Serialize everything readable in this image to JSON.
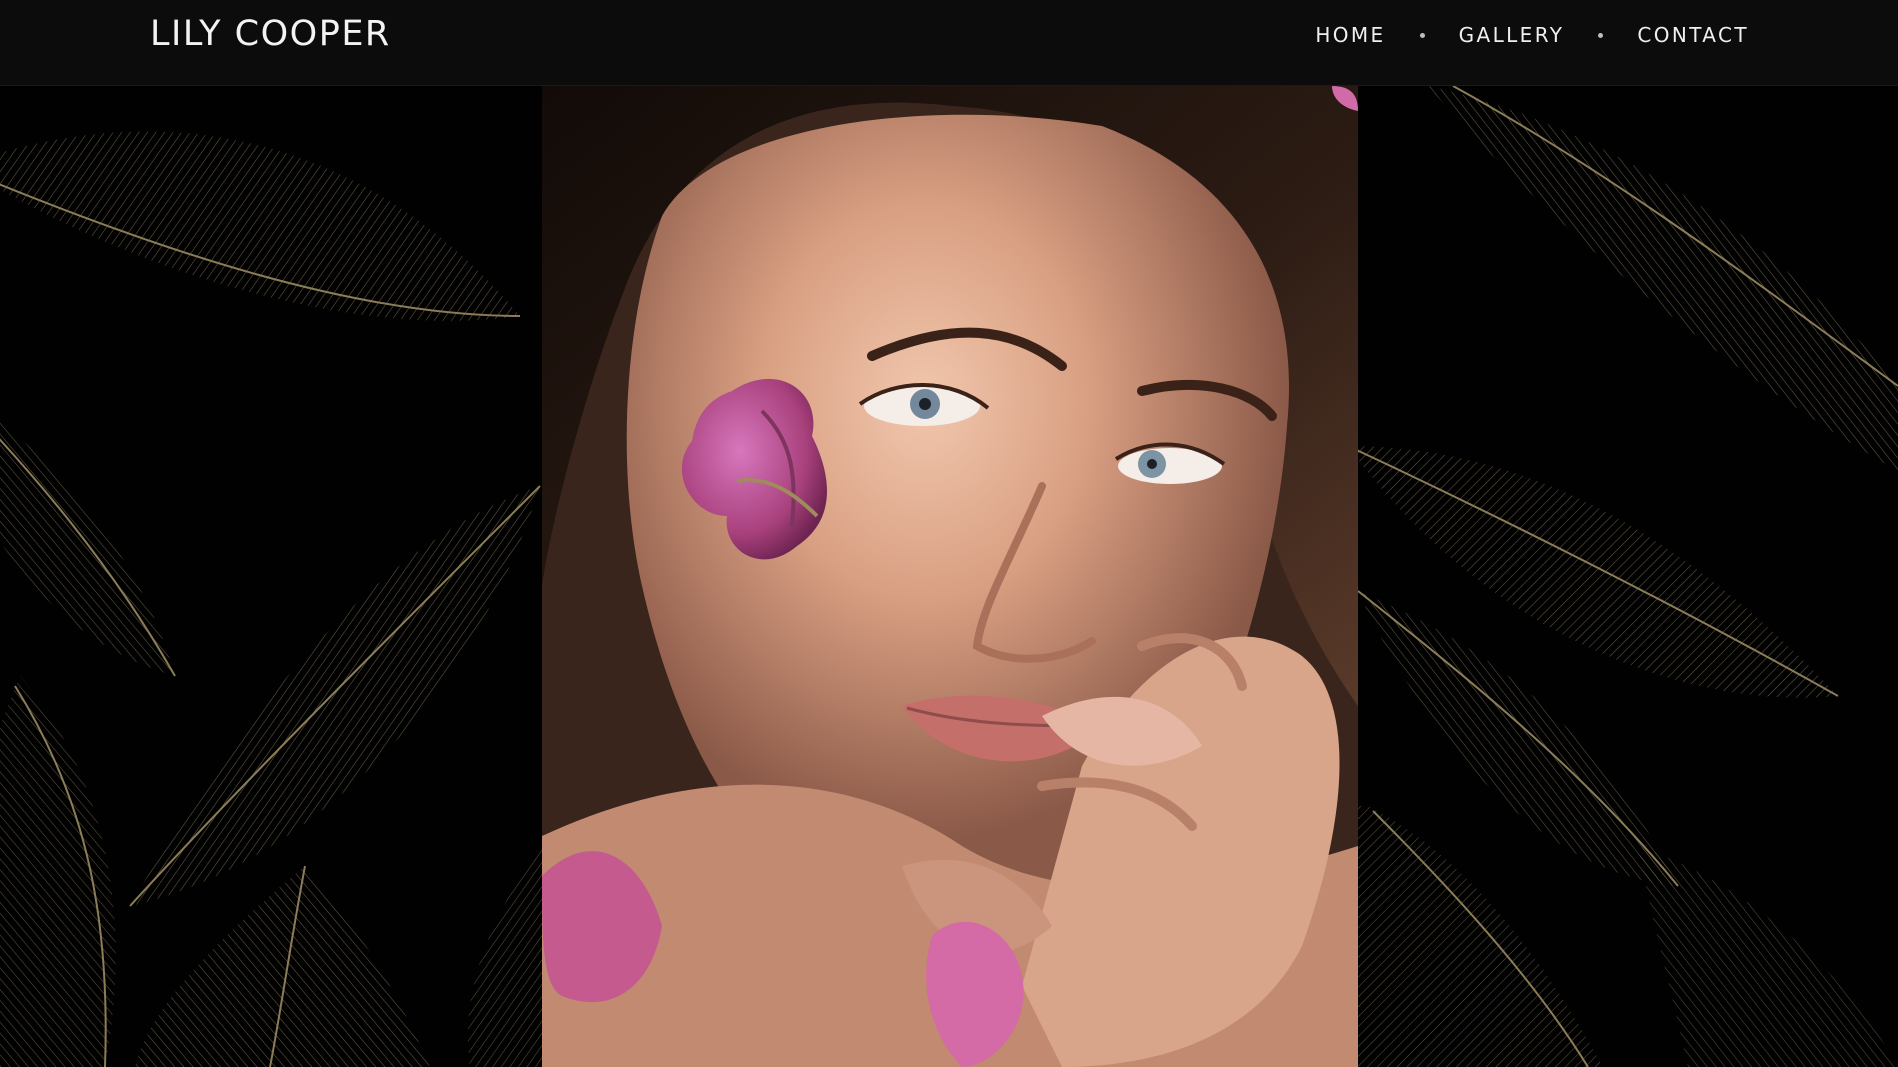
{
  "header": {
    "brand": "LILY COOPER",
    "nav": {
      "home": "HOME",
      "gallery": "GALLERY",
      "contact": "CONTACT"
    }
  },
  "hero": {
    "subject": "portrait of woman with pink bougainvillea petal on cheek"
  },
  "colors": {
    "header_bg": "#0c0c0c",
    "page_bg": "#020202",
    "leaf_line": "#6f6548",
    "text": "#efefef",
    "petal": "#b84c96"
  }
}
